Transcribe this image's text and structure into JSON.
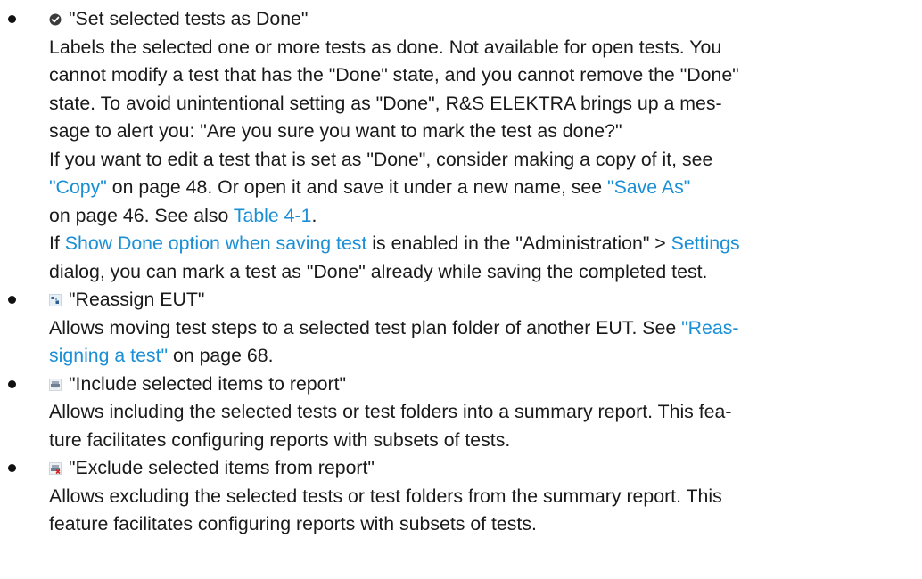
{
  "items": [
    {
      "icon": "check-circle-icon",
      "title": "\"Set selected tests as Done\"",
      "lines": {
        "p1_l1": "Labels the selected one or more tests as done. Not available for open tests. You",
        "p1_l2": "cannot modify a test that has the \"Done\" state, and you cannot remove the \"Done\"",
        "p1_l3": "state. To avoid unintentional setting as \"Done\", R&S ELEKTRA brings up a mes-",
        "p1_l4": "sage to alert you: \"Are you sure you want to mark the test as done?\"",
        "p2_l1": "If you want to edit a test that is set as \"Done\", consider making a copy of it, see",
        "p2_link_copy": "\"Copy\"",
        "p2_l2_mid": " on page 48. Or open it and save it under a new name, see ",
        "p2_link_saveas": "\"Save As\"",
        "p2_l3_pre": "on page 46. See also ",
        "p2_link_table": "Table 4-1",
        "p2_l3_post": ".",
        "p3_pre": "If ",
        "p3_link_option": "Show Done option when saving test",
        "p3_mid": " is enabled in the \"Administration\" > ",
        "p3_link_settings": "Settings",
        "p3_l2": "dialog, you can mark a test as \"Done\" already while saving the completed test."
      }
    },
    {
      "icon": "reassign-icon",
      "title": "\"Reassign EUT\"",
      "lines": {
        "l1_pre": "Allows moving test steps to a selected test plan folder of another EUT. See ",
        "l1_link": "\"Reas-",
        "l2_link": "signing a test\"",
        "l2_post": " on page 68."
      }
    },
    {
      "icon": "include-report-icon",
      "title": "\"Include selected items to report\"",
      "lines": {
        "l1": "Allows including the selected tests or test folders into a summary report. This fea-",
        "l2": "ture facilitates configuring reports with subsets of tests."
      }
    },
    {
      "icon": "exclude-report-icon",
      "title": "\"Exclude selected items from report\"",
      "lines": {
        "l1": "Allows excluding the selected tests or test folders from the summary report. This",
        "l2": "feature facilitates configuring reports with subsets of tests."
      }
    }
  ],
  "colors": {
    "text": "#1a1a1a",
    "link": "#1a8fd6"
  }
}
